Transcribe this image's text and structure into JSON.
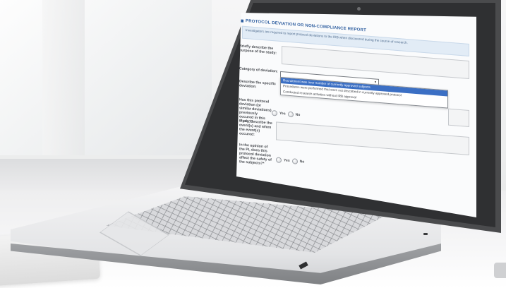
{
  "report": {
    "title": "PROTOCOL DEVIATION OR NON-COMPLIANCE REPORT",
    "instructions": "Investigators are required to report protocol deviations to the IRB when discovered during the course of research."
  },
  "questions": {
    "q1_label": "Briefly describe the purpose of the study:",
    "q2_label": "Category of deviation:",
    "q3_label": "Describe the specific deviation:",
    "q4_label": "Has this protocol deviation (or similar deviations) previously occured in this study?*",
    "q5_label": "If yes, describe the event(s) and when the event(s) occured:",
    "q6_label": "In the opinion of the PI, does this protocol deviation affect the safety of the subjects?*"
  },
  "dropdown": {
    "options": [
      "Recruitment was over number of currently approved subjects",
      "Procedures were performed that were not described in currently approved protocol",
      "Conducted research activities without IRB approval"
    ],
    "selected_index": 0
  },
  "radio": {
    "yes_label": "Yes",
    "no_label": "No"
  }
}
